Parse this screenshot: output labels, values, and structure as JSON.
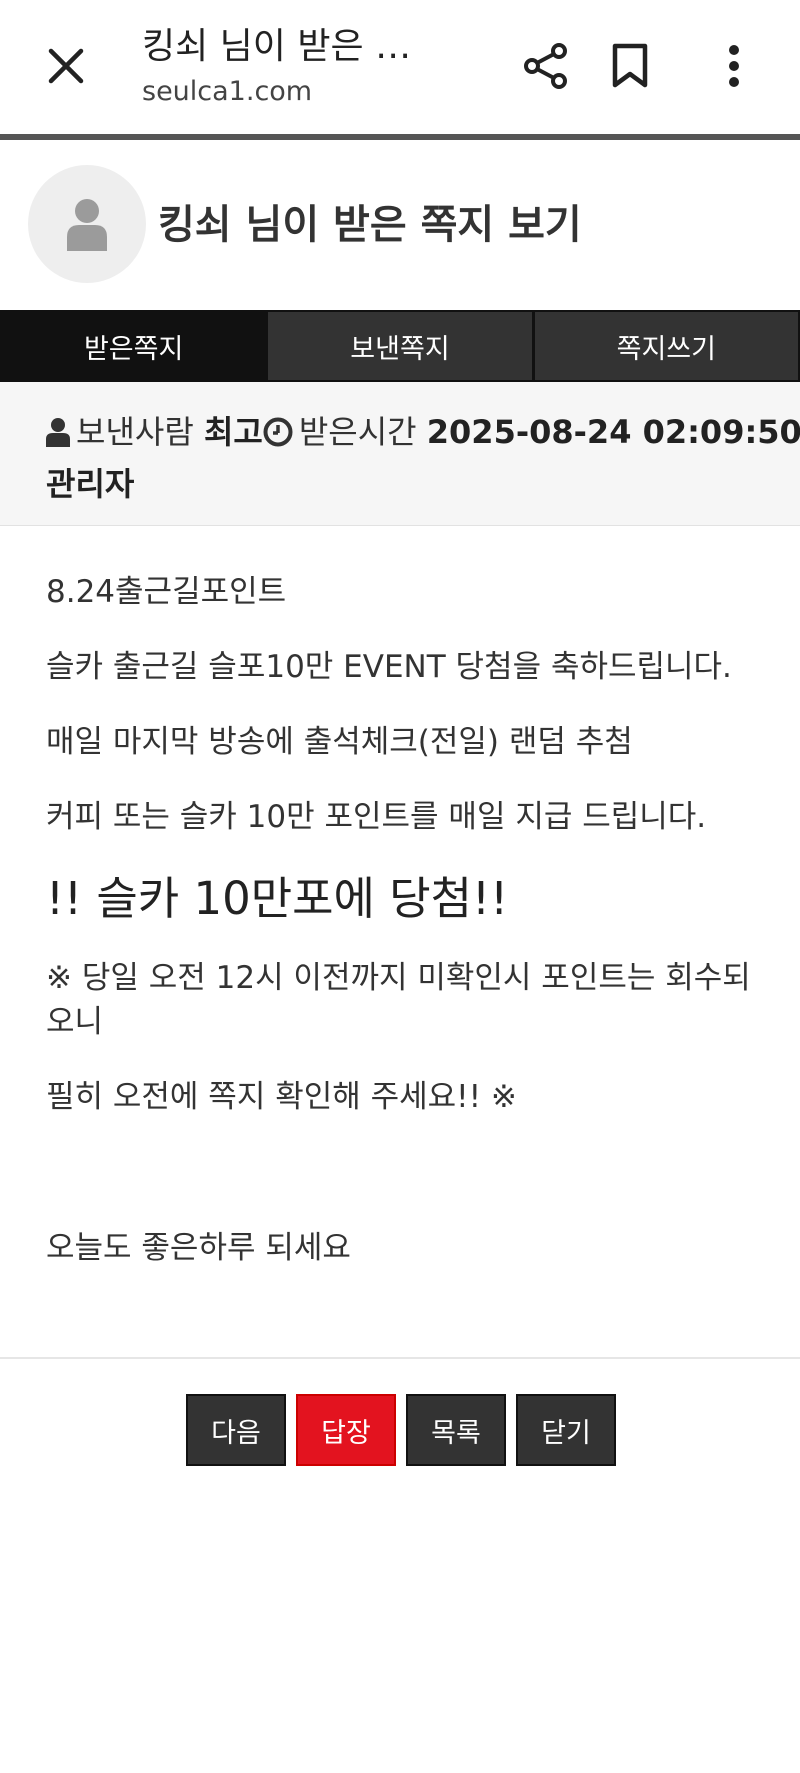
{
  "browser": {
    "title": "킹쇠 님이 받은 쪽...",
    "url": "seulca1.com",
    "icons": {
      "close": "close-icon",
      "share": "share-icon",
      "bookmark": "bookmark-icon",
      "more": "more-vertical-icon"
    }
  },
  "header": {
    "title": "킹쇠 님이 받은 쪽지 보기",
    "avatar_icon": "user-avatar-icon"
  },
  "tabs": [
    {
      "label": "받은쪽지",
      "active": true
    },
    {
      "label": "보낸쪽지",
      "active": false
    },
    {
      "label": "쪽지쓰기",
      "active": false
    }
  ],
  "info": {
    "sender_label": "보낸사람",
    "sender_name": "최고",
    "received_label": "받은시간",
    "received_time": "2025-08-24 02:09:50",
    "sender_role": "관리자"
  },
  "message": {
    "line1": "8.24출근길포인트",
    "line2": "슬카 출근길 슬포10만 EVENT 당첨을 축하드립니다.",
    "line3": "매일 마지막 방송에 출석체크(전일) 랜덤 추첨",
    "line4": "커피 또는 슬카 10만 포인트를 매일 지급 드립니다.",
    "headline": "!! 슬카 10만포에 당첨!!",
    "notice1": "※ 당일 오전 12시 이전까지 미확인시 포인트는 회수되오니",
    "notice2": "필히 오전에 쪽지 확인해 주세요!! ※",
    "closing": "오늘도 좋은하루 되세요"
  },
  "buttons": {
    "next": "다음",
    "reply": "답장",
    "list": "목록",
    "close": "닫기"
  },
  "colors": {
    "reply_button": "#e3131f",
    "dark_button": "#333333",
    "active_tab": "#111111"
  }
}
